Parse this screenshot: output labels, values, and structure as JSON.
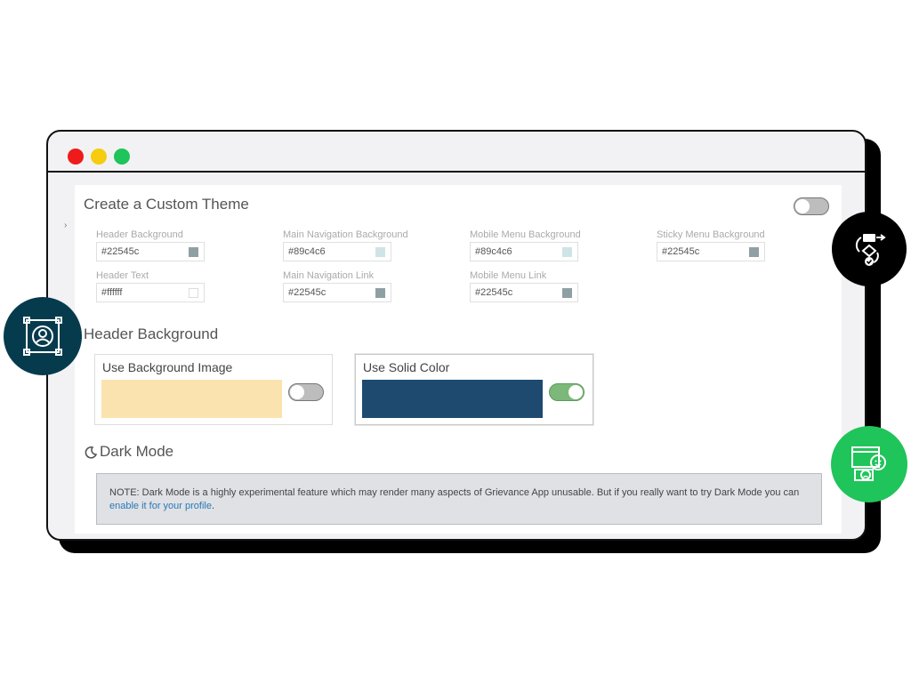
{
  "window": {
    "traffic_lights": [
      "close",
      "minimize",
      "maximize"
    ]
  },
  "theme_panel": {
    "title": "Create a Custom Theme",
    "enabled": false,
    "fields": [
      {
        "label": "Header Background",
        "value": "#22545c",
        "swatch": "#8fa0a5"
      },
      {
        "label": "Main Navigation Background",
        "value": "#89c4c6",
        "swatch": "#cfe4e6"
      },
      {
        "label": "Mobile Menu Background",
        "value": "#89c4c6",
        "swatch": "#cfe4e6"
      },
      {
        "label": "Sticky Menu Background",
        "value": "#22545c",
        "swatch": "#8fa0a5"
      },
      {
        "label": "Header Text",
        "value": "#ffffff",
        "swatch": "#ffffff"
      },
      {
        "label": "Main Navigation Link",
        "value": "#22545c",
        "swatch": "#8fa0a5"
      },
      {
        "label": "Mobile Menu Link",
        "value": "#22545c",
        "swatch": "#8fa0a5"
      }
    ]
  },
  "header_background": {
    "title": "Header Background",
    "options": [
      {
        "label": "Use Background Image",
        "preview_color": "#fbe3b0",
        "enabled": false
      },
      {
        "label": "Use Solid Color",
        "preview_color": "#1e4a70",
        "enabled": true
      }
    ]
  },
  "dark_mode": {
    "title": "Dark Mode",
    "note_text": "NOTE: Dark Mode is a highly experimental feature which may render many aspects of Grievance App unusable. But if you really want to try Dark Mode you can",
    "note_link": "enable it for your profile",
    "note_end": "."
  },
  "colors": {
    "toggle_on": "#7cb879",
    "toggle_off": "#bdbdbd",
    "link": "#2a78b6"
  },
  "badges": [
    "profile-frame-icon",
    "workflow-icon",
    "feedback-icon"
  ]
}
